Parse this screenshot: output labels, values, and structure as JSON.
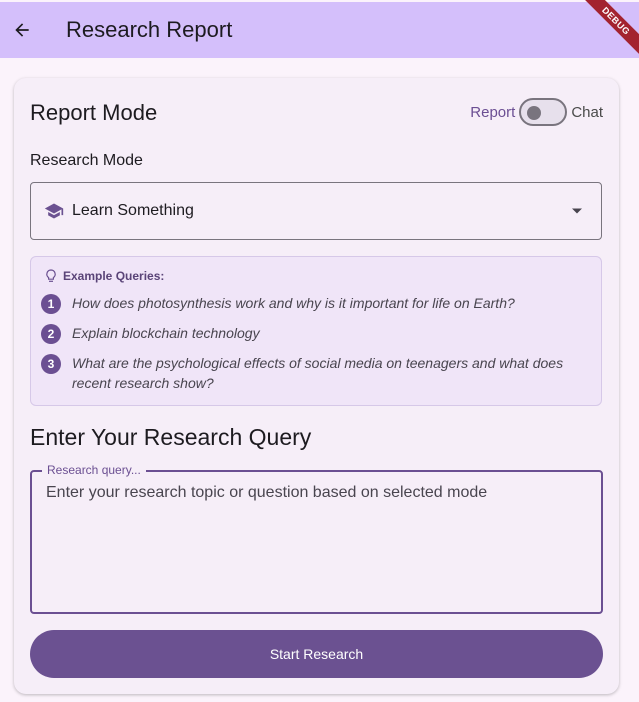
{
  "appbar": {
    "title": "Research Report",
    "debug_banner": "DEBUG"
  },
  "card": {
    "mode_title": "Report Mode",
    "toggle": {
      "left_label": "Report",
      "right_label": "Chat",
      "state": "off"
    },
    "research_mode_label": "Research Mode",
    "dropdown": {
      "icon": "school-icon",
      "selected": "Learn Something"
    },
    "examples": {
      "heading": "Example Queries:",
      "items": [
        {
          "num": "1",
          "text": "How does photosynthesis work and why is it important for life on Earth?"
        },
        {
          "num": "2",
          "text": "Explain blockchain technology"
        },
        {
          "num": "3",
          "text": "What are the psychological effects of social media on teenagers and what does recent research show?"
        }
      ]
    },
    "query": {
      "title": "Enter Your Research Query",
      "label": "Research query...",
      "placeholder": "Enter your research topic or question based on selected mode"
    },
    "start_button": "Start Research"
  },
  "colors": {
    "appbar": "#d4bffb",
    "primary": "#6b5191",
    "card": "#f6eef8",
    "examples_bg": "#f0e5f8",
    "debug": "#a3232f"
  }
}
